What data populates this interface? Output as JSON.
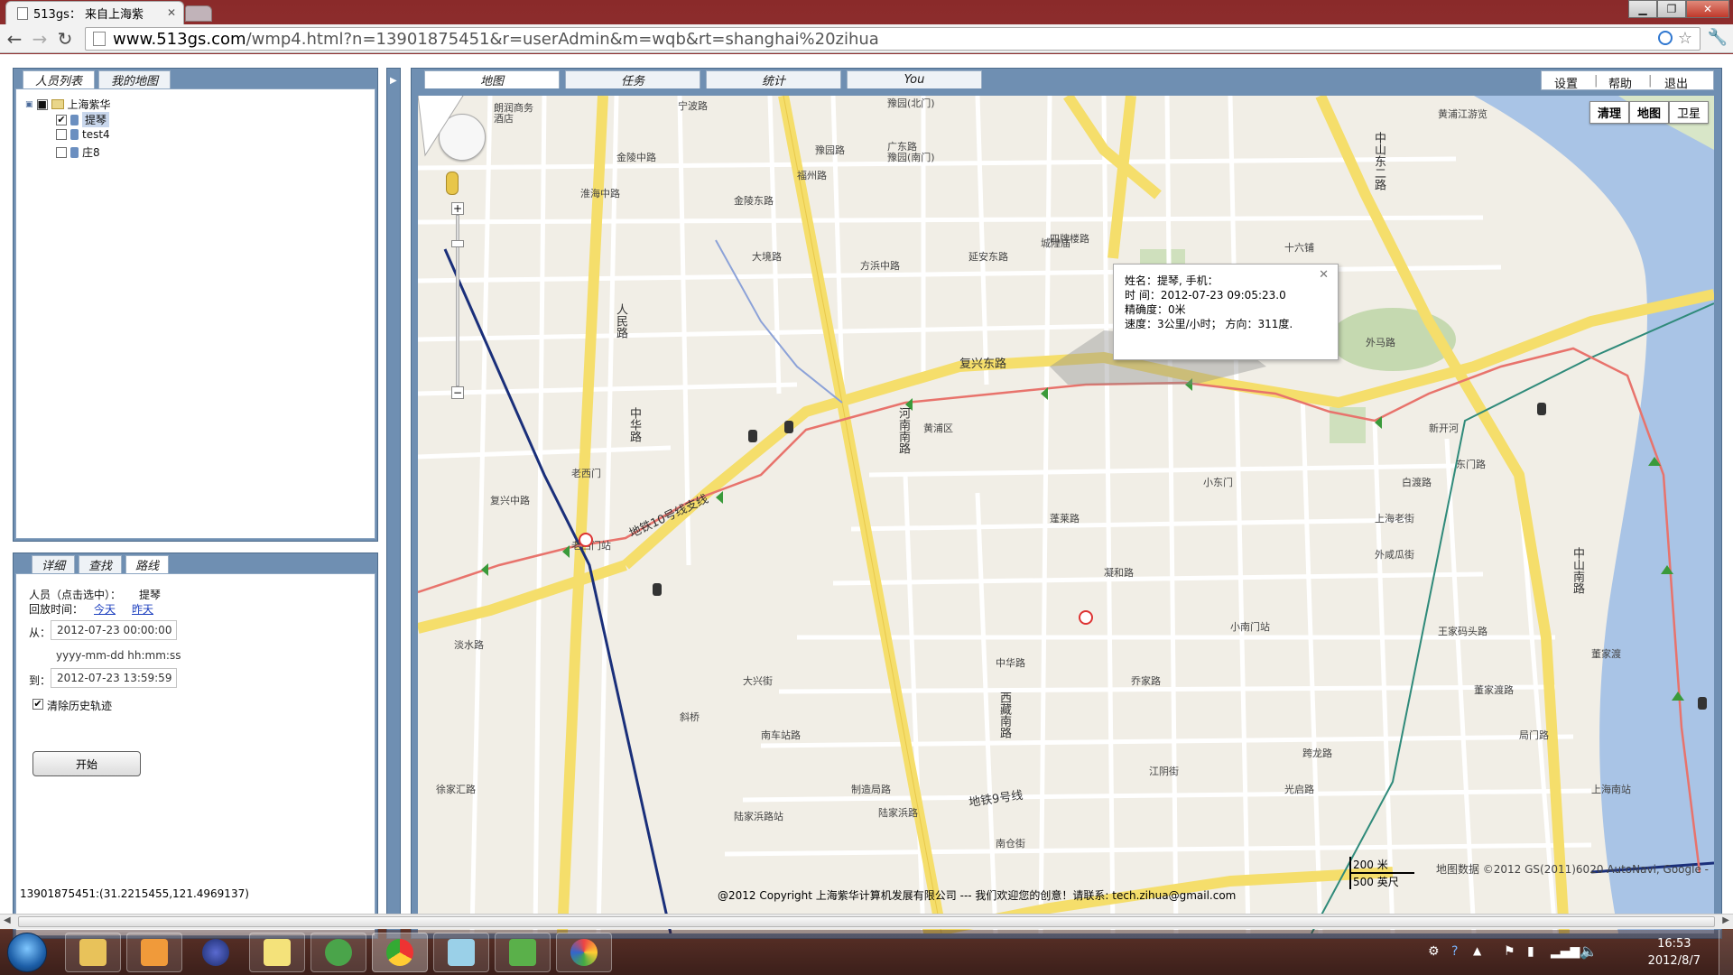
{
  "browser": {
    "tab_title": "513gs： 来自上海紫",
    "url_host": "www.513gs.com",
    "url_path": "/wmp4.html?n=13901875451&r=userAdmin&m=wqb&rt=shanghai%20zihua",
    "window_controls": [
      "minimize-icon",
      "maximize-icon",
      "close-icon"
    ]
  },
  "left_top": {
    "tabs": [
      "人员列表",
      "我的地图"
    ],
    "tree": {
      "root": "上海紫华",
      "children": [
        {
          "label": "提琴",
          "checked": true,
          "selected": true
        },
        {
          "label": "test4",
          "checked": false,
          "selected": false
        },
        {
          "label": "庄8",
          "checked": false,
          "selected": false
        }
      ]
    }
  },
  "left_bot": {
    "tabs": [
      "详细",
      "查找",
      "路线"
    ],
    "person_label": "人员（点击选中）：",
    "person_value": "提琴",
    "playback_label": "回放时间：",
    "today": "今天",
    "yesterday": "昨天",
    "from_label": "从：",
    "from_value": "2012-07-23 00:00:00",
    "format_hint": "yyyy-mm-dd hh:mm:ss",
    "to_label": "到：",
    "to_value": "2012-07-23 13:59:59",
    "clear_history_label": "清除历史轨迹",
    "clear_history_checked": true,
    "start_button": "开始"
  },
  "main": {
    "tabs": [
      "地图",
      "任务",
      "统计",
      "You"
    ],
    "top_links": [
      "设置",
      "帮助",
      "退出"
    ],
    "map_types": [
      "清理",
      "地图",
      "卫星"
    ],
    "info": {
      "line1": "姓名：提琴, 手机：",
      "line2": "时 间：2012-07-23 09:05:23.0",
      "line3": "精确度：0米",
      "line4": "速度：3公里/小时；    方向：311度."
    },
    "scale_metric": "200 米",
    "scale_imperial": "500 英尺",
    "map_copyright": "地图数据 ©2012 GS(2011)6020 AutoNavi, Google -"
  },
  "map_labels": [
    "朗润商务",
    "酒店",
    "金陵中路",
    "宁波路",
    "豫园(北门)",
    "黄浦江游览",
    "福州路",
    "广东路",
    "豫园(南门)",
    "豫园路",
    "复兴东路",
    "人民路",
    "中华路",
    "河南南路",
    "方浜中路",
    "老西门",
    "西藏南路",
    "中山南路",
    "外马路",
    "董家渡路",
    "中山东二路",
    "大境路",
    "淮海中路",
    "金陵东路",
    "延安东路",
    "十六铺",
    "上海老街",
    "城隍庙",
    "小东门",
    "南仓街",
    "地铁10号线支线",
    "地铁9号线",
    "陆家浜路",
    "陆家浜路站",
    "小南门站",
    "老西门站",
    "江阴街",
    "蓬莱路",
    "乔家路",
    "中华路",
    "黄浦区",
    "斜桥",
    "制造局路",
    "大兴街",
    "南车站路",
    "复兴中路",
    "淡水路",
    "徐家汇路",
    "凝和路",
    "跨龙路",
    "白渡路",
    "王家码头路",
    "董家渡",
    "外咸瓜街",
    "东门路",
    "新开河",
    "上海南站",
    "局门路",
    "光启路",
    "四牌楼路"
  ],
  "statusbar": {
    "coords": "13901875451:(31.2215455,121.4969137)",
    "footer": "@2012 Copyright    上海紫华计算机发展有限公司    --- 我们欢迎您的创意！请联系: tech.zihua@gmail.com"
  },
  "taskbar": {
    "time": "16:53",
    "date": "2012/8/7"
  },
  "colors": {
    "panel_border": "#6f8fb2",
    "road_major": "#f5de6b",
    "road_minor": "#ffffff",
    "track_line": "#e8736c",
    "metro_line": "#1a2f7a",
    "river": "#a9c4e6"
  }
}
